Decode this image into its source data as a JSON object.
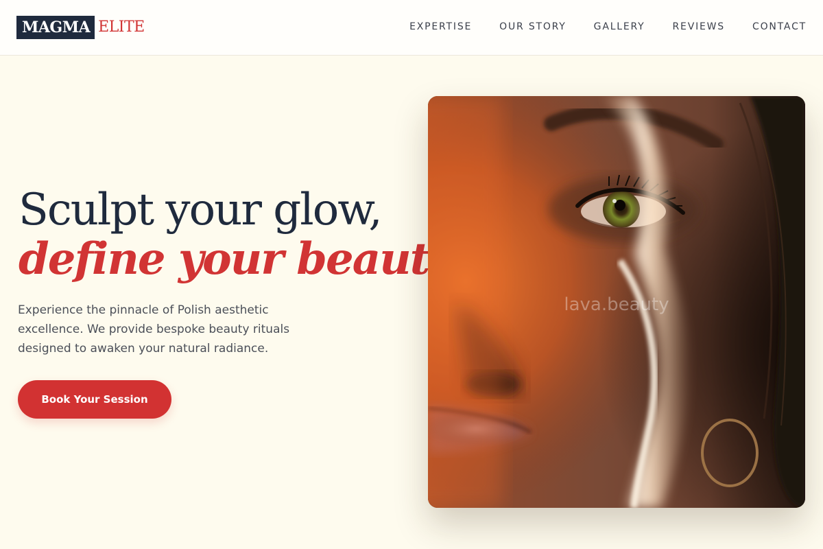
{
  "brand": {
    "part1": "MAGMA",
    "part2": "ELITE"
  },
  "nav": {
    "items": [
      {
        "label": "EXPERTISE"
      },
      {
        "label": "OUR STORY"
      },
      {
        "label": "GALLERY"
      },
      {
        "label": "REVIEWS"
      },
      {
        "label": "CONTACT"
      }
    ]
  },
  "hero": {
    "headline_line1": "Sculpt your glow,",
    "headline_line2": "define your beauty.",
    "description": "Experience the pinnacle of Polish aesthetic excellence. We provide bespoke beauty rituals designed to awaken your natural radiance.",
    "cta_label": "Book Your Session",
    "image_watermark": "lava.beauty"
  },
  "colors": {
    "accent": "#d13434",
    "navy": "#1f2a3d",
    "background": "#fefbee"
  }
}
